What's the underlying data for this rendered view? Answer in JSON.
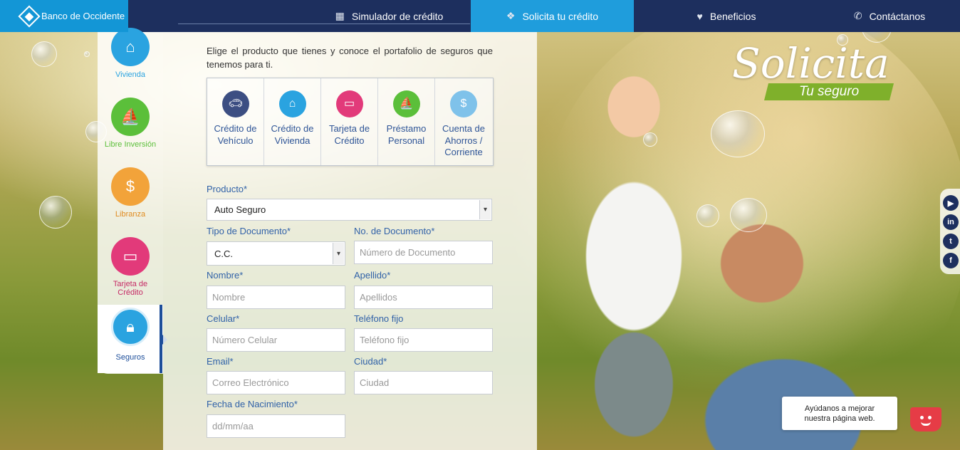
{
  "brand": {
    "name": "Banco de Occidente"
  },
  "nav": {
    "items": [
      {
        "label": "Simulador de crédito",
        "icon": "calculator-icon"
      },
      {
        "label": "Solicita tu crédito",
        "icon": "hands-icon",
        "active": true
      },
      {
        "label": "Beneficios",
        "icon": "heart-hands-icon"
      },
      {
        "label": "Contáctanos",
        "icon": "phone-icon"
      }
    ]
  },
  "sidebar": {
    "items": [
      {
        "label": "Vivienda",
        "icon": "house-icon",
        "color": "#2aa3e0"
      },
      {
        "label": "Libre Inversión",
        "icon": "sailboat-icon",
        "color": "#5bbf3a"
      },
      {
        "label": "Libranza",
        "icon": "coins-icon",
        "color": "#f2a33a"
      },
      {
        "label": "Tarjeta de Crédito",
        "icon": "credit-card-icon",
        "color": "#e23a7a"
      },
      {
        "label": "Seguros",
        "icon": "lock-icon",
        "color": "#2aa3e0",
        "active": true
      }
    ]
  },
  "intro": "Elige el producto que tienes y conoce el portafolio de seguros que tenemos para ti.",
  "products": [
    {
      "label": "Crédito de Vehículo",
      "icon": "car-icon",
      "color": "#3c4e82"
    },
    {
      "label": "Crédito de Vivienda",
      "icon": "house-icon",
      "color": "#2aa3e0"
    },
    {
      "label": "Tarjeta de Crédito",
      "icon": "credit-card-icon",
      "color": "#e23a7a"
    },
    {
      "label": "Préstamo Personal",
      "icon": "sailboat-icon",
      "color": "#5bbf3a"
    },
    {
      "label": "Cuenta de Ahorros / Corriente",
      "icon": "savings-icon",
      "color": "#7fc2ea"
    }
  ],
  "form": {
    "producto": {
      "label": "Producto*",
      "value": "Auto Seguro"
    },
    "tipo_documento": {
      "label": "Tipo de Documento*",
      "value": "C.C."
    },
    "no_documento": {
      "label": "No. de Documento*",
      "placeholder": "Número de Documento"
    },
    "nombre": {
      "label": "Nombre*",
      "placeholder": "Nombre"
    },
    "apellido": {
      "label": "Apellido*",
      "placeholder": "Apellidos"
    },
    "celular": {
      "label": "Celular*",
      "placeholder": "Número Celular"
    },
    "telefono": {
      "label": "Teléfono fijo",
      "placeholder": "Teléfono fijo"
    },
    "email": {
      "label": "Email*",
      "placeholder": "Correo Electrónico"
    },
    "ciudad": {
      "label": "Ciudad*",
      "placeholder": "Ciudad"
    },
    "fecha": {
      "label": "Fecha de Nacimiento*",
      "placeholder": "dd/mm/aa"
    }
  },
  "hero": {
    "title": "Solicita",
    "subtitle": "Tu seguro"
  },
  "social": [
    {
      "icon": "youtube-icon",
      "glyph": "▶"
    },
    {
      "icon": "linkedin-icon",
      "glyph": "in"
    },
    {
      "icon": "twitter-icon",
      "glyph": "t"
    },
    {
      "icon": "facebook-icon",
      "glyph": "f"
    }
  ],
  "feedback": {
    "text": "Ayúdanos a mejorar nuestra página web."
  }
}
